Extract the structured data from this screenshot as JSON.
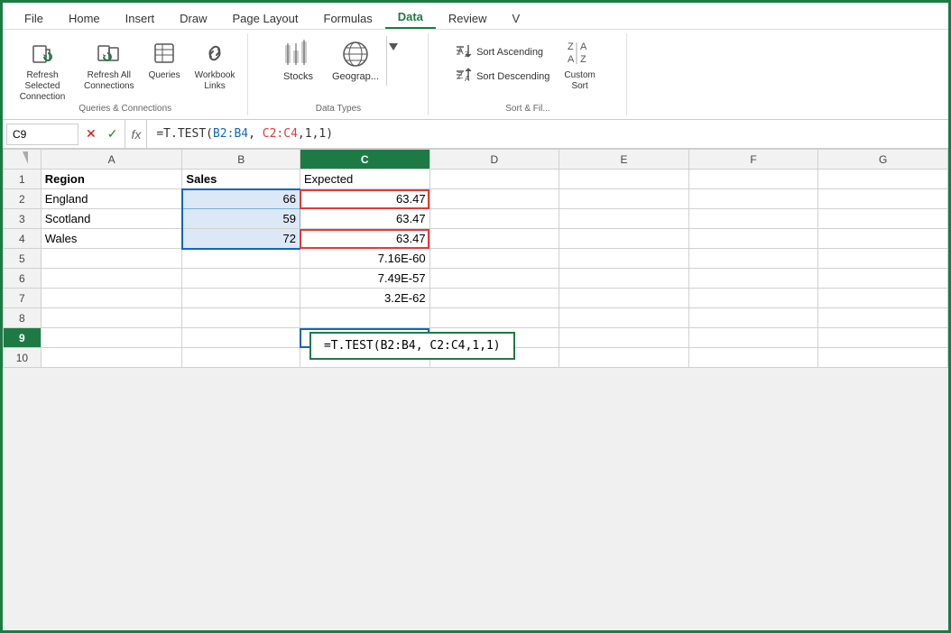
{
  "menu": {
    "items": [
      "File",
      "Home",
      "Insert",
      "Draw",
      "Page Layout",
      "Formulas",
      "Data",
      "Review",
      "V"
    ],
    "active": "Data"
  },
  "ribbon": {
    "groups": [
      {
        "id": "queries-connections",
        "label": "Queries & Connections",
        "buttons": [
          {
            "id": "refresh-selected",
            "label": "Refresh Selected\nConnection",
            "icon": "refresh-selected-icon"
          },
          {
            "id": "refresh-all",
            "label": "Refresh All\nConnections",
            "icon": "refresh-all-icon"
          },
          {
            "id": "queries",
            "label": "Queries",
            "icon": "queries-icon"
          },
          {
            "id": "workbook-links",
            "label": "Workbook\nLinks",
            "icon": "workbook-links-icon"
          }
        ]
      },
      {
        "id": "data-types",
        "label": "Data Types",
        "buttons": [
          {
            "id": "stocks",
            "label": "Stocks",
            "icon": "stocks-icon"
          },
          {
            "id": "geography",
            "label": "Geograp...",
            "icon": "geography-icon"
          }
        ]
      },
      {
        "id": "sort-filter",
        "label": "Sort & Fil...",
        "sortItems": [
          {
            "id": "sort-ascending",
            "label": "Sort Ascending",
            "icon": "sort-asc-icon"
          },
          {
            "id": "sort-descending",
            "label": "Sort Descending",
            "icon": "sort-desc-icon"
          }
        ],
        "customSort": {
          "label": "Custom\nSort",
          "id": "custom-sort"
        }
      }
    ]
  },
  "formula_bar": {
    "cell_ref": "C9",
    "formula_text": "=T.TEST(B2:B4, C2:C4,1,1)",
    "formula_colored": {
      "prefix": "=T.TEST(",
      "arg1": "B2:B4",
      "separator": ", ",
      "arg2": "C2:C4",
      "suffix": ",1,1)"
    },
    "fx_label": "fx"
  },
  "spreadsheet": {
    "col_headers": [
      "",
      "A",
      "B",
      "C",
      "D",
      "E",
      "F",
      "G"
    ],
    "rows": [
      {
        "row_num": "1",
        "cells": [
          {
            "col": "A",
            "value": "Region",
            "bold": true
          },
          {
            "col": "B",
            "value": "Sales",
            "bold": true
          },
          {
            "col": "C",
            "value": "Expected",
            "state": "normal"
          },
          {
            "col": "D",
            "value": ""
          },
          {
            "col": "E",
            "value": ""
          },
          {
            "col": "F",
            "value": ""
          },
          {
            "col": "G",
            "value": ""
          }
        ]
      },
      {
        "row_num": "2",
        "cells": [
          {
            "col": "A",
            "value": "England"
          },
          {
            "col": "B",
            "value": "66",
            "align": "right",
            "state": "selected"
          },
          {
            "col": "C",
            "value": "63.47",
            "align": "right",
            "state": "c-red-border"
          },
          {
            "col": "D",
            "value": ""
          },
          {
            "col": "E",
            "value": ""
          },
          {
            "col": "F",
            "value": ""
          },
          {
            "col": "G",
            "value": ""
          }
        ]
      },
      {
        "row_num": "3",
        "cells": [
          {
            "col": "A",
            "value": "Scotland"
          },
          {
            "col": "B",
            "value": "59",
            "align": "right",
            "state": "selected"
          },
          {
            "col": "C",
            "value": "63.47",
            "align": "right"
          },
          {
            "col": "D",
            "value": ""
          },
          {
            "col": "E",
            "value": ""
          },
          {
            "col": "F",
            "value": ""
          },
          {
            "col": "G",
            "value": ""
          }
        ]
      },
      {
        "row_num": "4",
        "cells": [
          {
            "col": "A",
            "value": "Wales"
          },
          {
            "col": "B",
            "value": "72",
            "align": "right",
            "state": "selected-bottom"
          },
          {
            "col": "C",
            "value": "63.47",
            "align": "right",
            "state": "c-red-border-bottom"
          },
          {
            "col": "D",
            "value": ""
          },
          {
            "col": "E",
            "value": ""
          },
          {
            "col": "F",
            "value": ""
          },
          {
            "col": "G",
            "value": ""
          }
        ]
      },
      {
        "row_num": "5",
        "cells": [
          {
            "col": "A",
            "value": ""
          },
          {
            "col": "B",
            "value": ""
          },
          {
            "col": "C",
            "value": "7.16E-60",
            "align": "right"
          },
          {
            "col": "D",
            "value": ""
          },
          {
            "col": "E",
            "value": ""
          },
          {
            "col": "F",
            "value": ""
          },
          {
            "col": "G",
            "value": ""
          }
        ]
      },
      {
        "row_num": "6",
        "cells": [
          {
            "col": "A",
            "value": ""
          },
          {
            "col": "B",
            "value": ""
          },
          {
            "col": "C",
            "value": "7.49E-57",
            "align": "right"
          },
          {
            "col": "D",
            "value": ""
          },
          {
            "col": "E",
            "value": ""
          },
          {
            "col": "F",
            "value": ""
          },
          {
            "col": "G",
            "value": ""
          }
        ]
      },
      {
        "row_num": "7",
        "cells": [
          {
            "col": "A",
            "value": ""
          },
          {
            "col": "B",
            "value": ""
          },
          {
            "col": "C",
            "value": "3.2E-62",
            "align": "right"
          },
          {
            "col": "D",
            "value": ""
          },
          {
            "col": "E",
            "value": ""
          },
          {
            "col": "F",
            "value": ""
          },
          {
            "col": "G",
            "value": ""
          }
        ]
      },
      {
        "row_num": "8",
        "cells": [
          {
            "col": "A",
            "value": ""
          },
          {
            "col": "B",
            "value": ""
          },
          {
            "col": "C",
            "value": ""
          },
          {
            "col": "D",
            "value": ""
          },
          {
            "col": "E",
            "value": ""
          },
          {
            "col": "F",
            "value": ""
          },
          {
            "col": "G",
            "value": ""
          }
        ]
      },
      {
        "row_num": "9",
        "active_row": true,
        "cells": [
          {
            "col": "A",
            "value": ""
          },
          {
            "col": "B",
            "value": ""
          },
          {
            "col": "C",
            "value": "",
            "state": "active"
          },
          {
            "col": "D",
            "value": ""
          },
          {
            "col": "E",
            "value": ""
          },
          {
            "col": "F",
            "value": ""
          },
          {
            "col": "G",
            "value": ""
          }
        ],
        "formula_tooltip": "=T.TEST(B2:B4, C2:C4,1,1)"
      },
      {
        "row_num": "10",
        "cells": [
          {
            "col": "A",
            "value": ""
          },
          {
            "col": "B",
            "value": ""
          },
          {
            "col": "C",
            "value": ""
          },
          {
            "col": "D",
            "value": ""
          },
          {
            "col": "E",
            "value": ""
          },
          {
            "col": "F",
            "value": ""
          },
          {
            "col": "G",
            "value": ""
          }
        ]
      }
    ]
  }
}
